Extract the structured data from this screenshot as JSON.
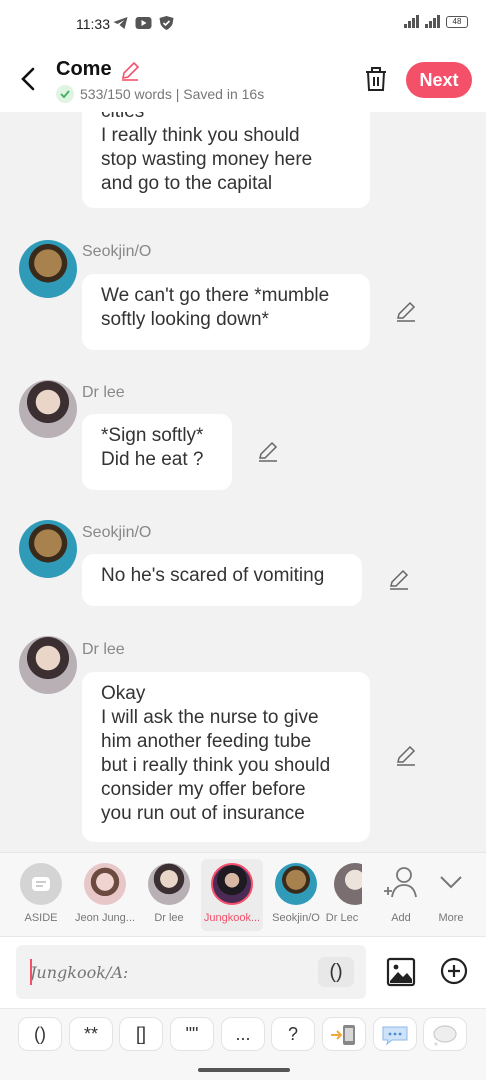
{
  "status": {
    "time": "11:33",
    "battery": "48"
  },
  "header": {
    "title": "Come",
    "saved_text": "533/150 words | Saved in 16s",
    "next_label": "Next"
  },
  "messages": [
    {
      "name": "",
      "text": "cities\nI really think you should\nstop wasting money here\nand go to the capital"
    },
    {
      "name": "Seokjin/O",
      "text": "We can't go there *mumble\nsoftly looking down*"
    },
    {
      "name": "Dr lee",
      "text": "*Sign softly*\nDid he eat ?"
    },
    {
      "name": "Seokjin/O",
      "text": "No he's scared of vomiting"
    },
    {
      "name": "Dr lee",
      "text": "Okay\nI will ask the nurse to give\nhim another feeding tube\nbut i really think you should\nconsider my offer before\nyou run out of insurance"
    }
  ],
  "characters": [
    {
      "label": "ASIDE"
    },
    {
      "label": "Jeon Jung..."
    },
    {
      "label": "Dr lee"
    },
    {
      "label": "Jungkook..."
    },
    {
      "label": "Seokjin/O"
    },
    {
      "label": "Dr Lec"
    },
    {
      "label": "Add"
    },
    {
      "label": "More"
    }
  ],
  "input": {
    "placeholder": "Jungkook/A:",
    "paren": "()"
  },
  "toolbar": [
    "()",
    "**",
    "[]",
    "\"\"",
    "..."
  ],
  "toolbar_q": "?",
  "colors": {
    "accent": "#f4506a",
    "background": "#f2f2f2"
  }
}
